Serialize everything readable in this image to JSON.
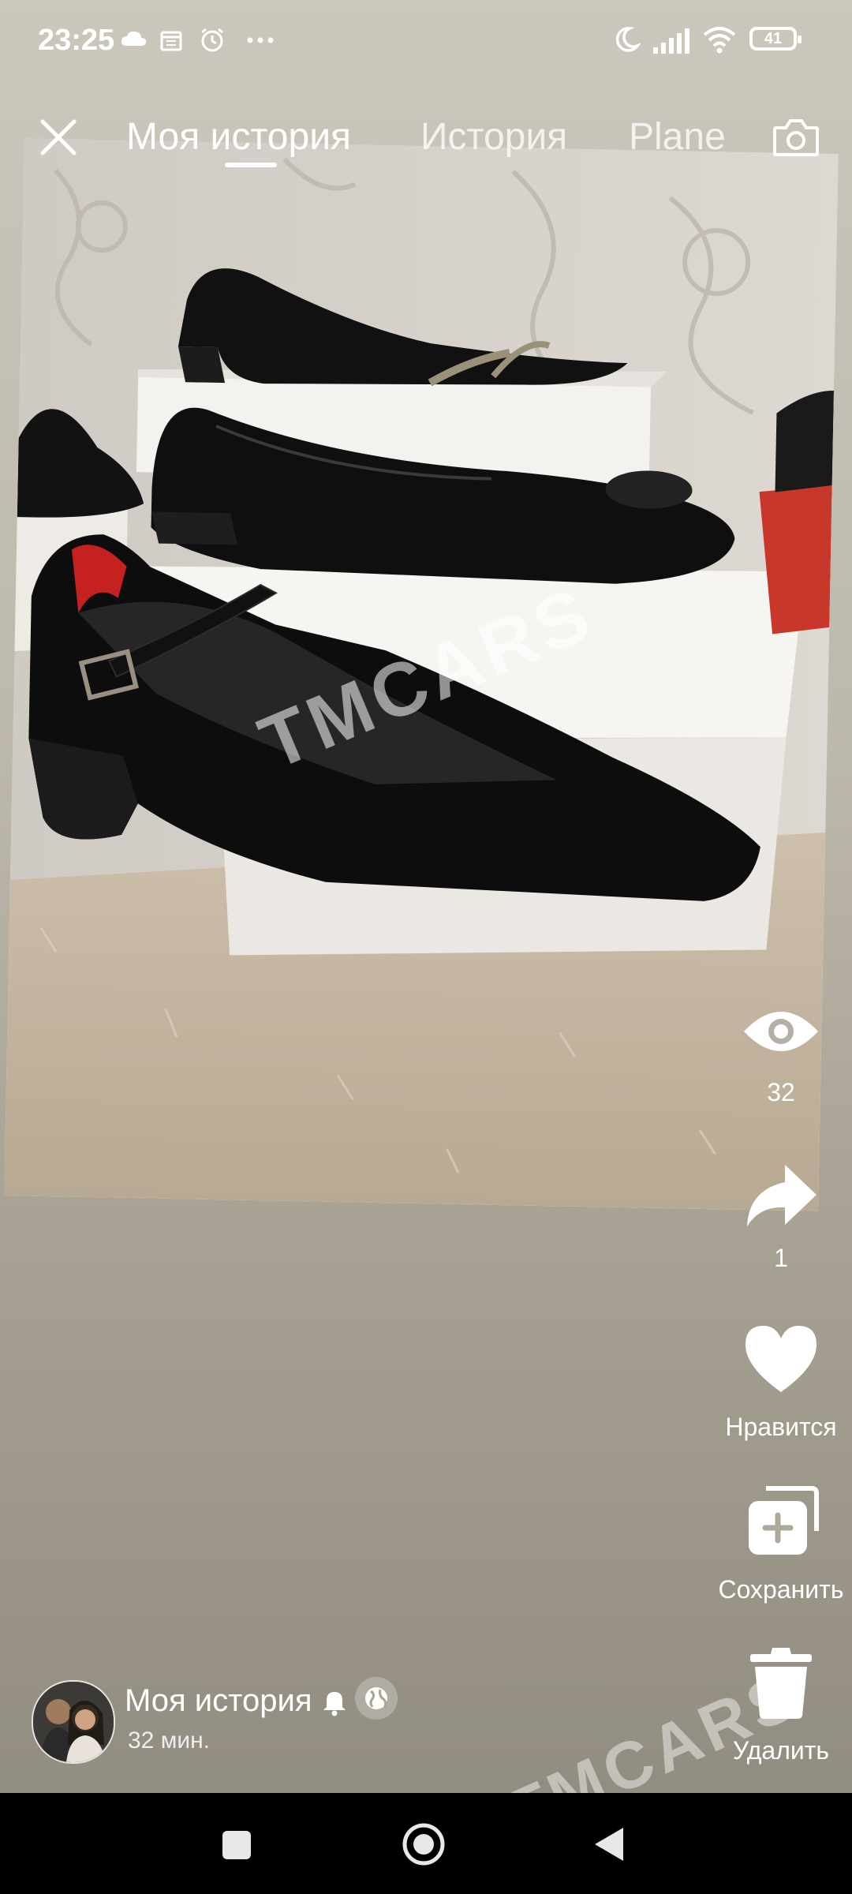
{
  "status_bar": {
    "time": "23:25",
    "battery": "41"
  },
  "top_nav": {
    "close_icon": "close-icon",
    "tabs": [
      {
        "label": "Моя история",
        "active": true
      },
      {
        "label": "История",
        "active": false
      },
      {
        "label": "Plane",
        "active": false
      }
    ],
    "camera_icon": "camera-icon"
  },
  "photo": {
    "watermark": "TMCARS"
  },
  "actions": {
    "views": {
      "icon": "eye-icon",
      "count": "32"
    },
    "shares": {
      "icon": "share-icon",
      "count": "1"
    },
    "like": {
      "icon": "heart-icon",
      "label": "Нравится"
    },
    "save": {
      "icon": "save-add-icon",
      "label": "Сохранить"
    },
    "delete": {
      "icon": "trash-icon",
      "label": "Удалить"
    }
  },
  "author": {
    "name": "Моя история",
    "time": "32 мин."
  },
  "overlay_watermark": "TMCARS",
  "colors": {
    "accent": "#ffffff",
    "nav_bg": "#000000"
  }
}
